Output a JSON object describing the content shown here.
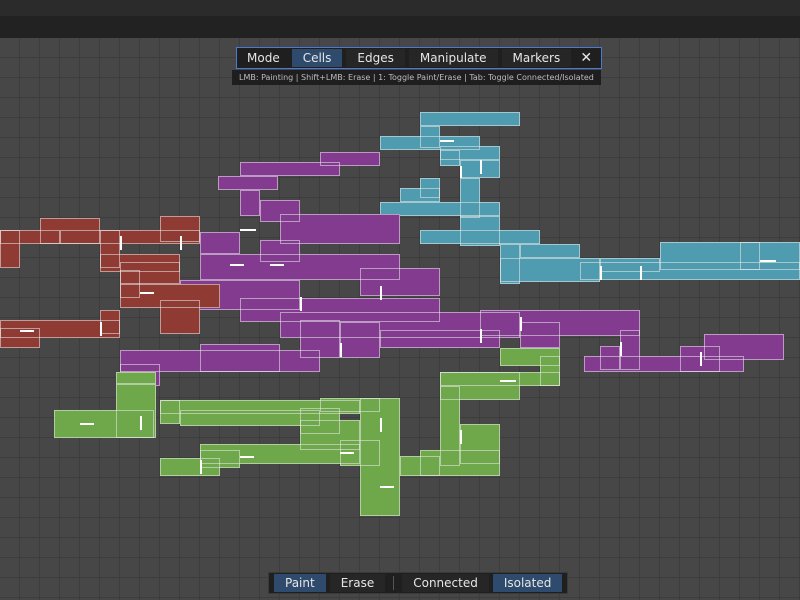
{
  "mode_toolbar": {
    "label": "Mode",
    "buttons": [
      {
        "label": "Cells",
        "active": true
      },
      {
        "label": "Edges",
        "active": false
      },
      {
        "label": "Manipulate",
        "active": false
      },
      {
        "label": "Markers",
        "active": false
      }
    ],
    "close_icon": "close-icon",
    "close_glyph": "✕"
  },
  "hint": "LMB: Painting | Shift+LMB: Erase | 1: Toggle Paint/Erase | Tab: Toggle Connected/Isolated",
  "bottom_toolbar": {
    "paint_label": "Paint",
    "erase_label": "Erase",
    "connected_label": "Connected",
    "isolated_label": "Isolated",
    "active_paint_mode": "Paint",
    "active_connect_mode": "Isolated"
  },
  "regions": [
    {
      "name": "teal",
      "color": "#4f9bb0"
    },
    {
      "name": "purple",
      "color": "#823b8e"
    },
    {
      "name": "red",
      "color": "#8f3b33"
    },
    {
      "name": "green",
      "color": "#6ea84a"
    }
  ]
}
